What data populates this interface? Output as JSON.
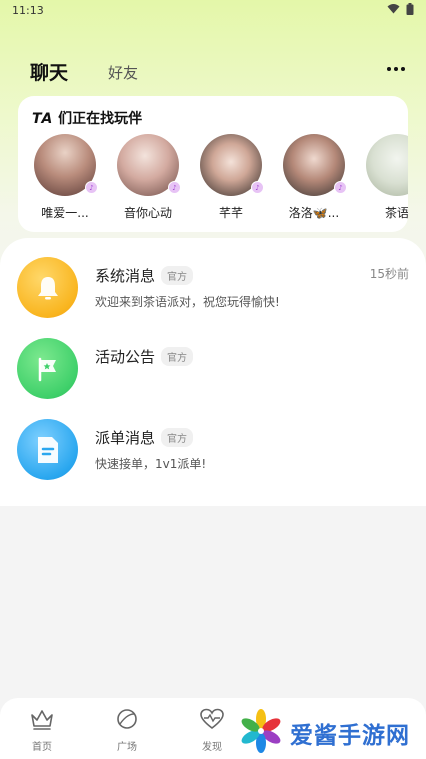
{
  "status_bar": {
    "time": "11:13"
  },
  "tabs": {
    "active": "聊天",
    "inactive": "好友"
  },
  "find_partner": {
    "title_prefix": "TA",
    "title_rest": " 们正在找玩伴",
    "players": [
      {
        "name": "唯爱一..."
      },
      {
        "name": "音你心动"
      },
      {
        "name": "芊芊"
      },
      {
        "name": "洛洛🦋..."
      },
      {
        "name": "茶语"
      }
    ]
  },
  "messages": [
    {
      "title": "系统消息",
      "badge": "官方",
      "subtitle": "欢迎来到茶语派对，祝您玩得愉快!",
      "time": "15秒前",
      "icon": "bell-icon",
      "color": "#f9b51f"
    },
    {
      "title": "活动公告",
      "badge": "官方",
      "subtitle": "",
      "time": "",
      "icon": "flag-star-icon",
      "color": "#3fd06a"
    },
    {
      "title": "派单消息",
      "badge": "官方",
      "subtitle": "快速接单，1v1派单!",
      "time": "",
      "icon": "document-icon",
      "color": "#2aa7ef"
    }
  ],
  "bottom_nav": {
    "items": [
      {
        "label": "首页",
        "icon": "crown-icon"
      },
      {
        "label": "广场",
        "icon": "planet-icon"
      },
      {
        "label": "发现",
        "icon": "heartbeat-icon"
      }
    ]
  },
  "watermark": {
    "text": "爱酱手游网"
  }
}
